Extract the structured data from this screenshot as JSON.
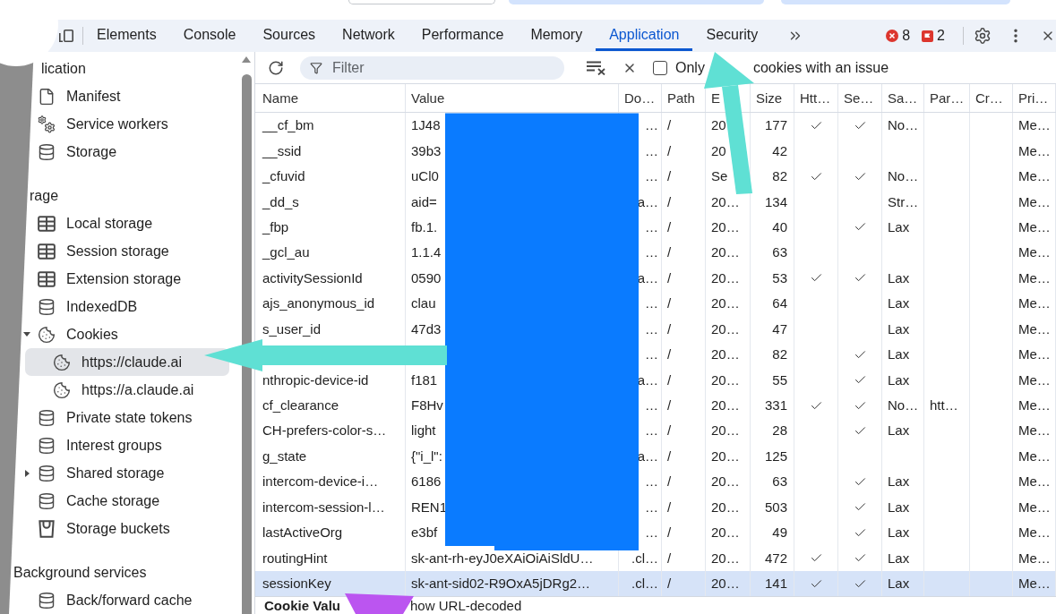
{
  "tabs": [
    {
      "label": "Elements",
      "selected": false
    },
    {
      "label": "Console",
      "selected": false
    },
    {
      "label": "Sources",
      "selected": false
    },
    {
      "label": "Network",
      "selected": false
    },
    {
      "label": "Performance",
      "selected": false
    },
    {
      "label": "Memory",
      "selected": false
    },
    {
      "label": "Application",
      "selected": true
    },
    {
      "label": "Security",
      "selected": false
    }
  ],
  "counters": {
    "errors": "8",
    "issues": "2"
  },
  "sidebar": {
    "sections": [
      {
        "title": "lication",
        "items": [
          {
            "label": "Manifest",
            "kind": "file",
            "selected": false
          },
          {
            "label": "Service workers",
            "kind": "gears",
            "selected": false
          },
          {
            "label": "Storage",
            "kind": "database",
            "selected": false
          }
        ]
      },
      {
        "title": "rage",
        "items": [
          {
            "label": "Local storage",
            "kind": "table",
            "selected": false
          },
          {
            "label": "Session storage",
            "kind": "table",
            "selected": false
          },
          {
            "label": "Extension storage",
            "kind": "table",
            "selected": false
          },
          {
            "label": "IndexedDB",
            "kind": "database",
            "selected": false
          },
          {
            "label": "Cookies",
            "kind": "cookie",
            "selected": false,
            "expanded": true,
            "children": [
              {
                "label": "https://claude.ai",
                "kind": "cookie",
                "selected": true
              },
              {
                "label": "https://a.claude.ai",
                "kind": "cookie",
                "selected": false
              }
            ]
          },
          {
            "label": "Private state tokens",
            "kind": "database",
            "selected": false
          },
          {
            "label": "Interest groups",
            "kind": "database",
            "selected": false
          },
          {
            "label": "Shared storage",
            "kind": "database",
            "selected": false,
            "expanded": false
          },
          {
            "label": "Cache storage",
            "kind": "database",
            "selected": false
          },
          {
            "label": "Storage buckets",
            "kind": "bucket",
            "selected": false
          }
        ]
      },
      {
        "title": "Background services",
        "items": [
          {
            "label": "Back/forward cache",
            "kind": "database",
            "selected": false
          }
        ]
      }
    ]
  },
  "toolbar": {
    "filter": {
      "placeholder": "Filter"
    },
    "only_issues": {
      "checked": false,
      "label": [
        "Only",
        "cookies with an issue"
      ]
    }
  },
  "table": {
    "columns": [
      "Name",
      "Value",
      "Do…",
      "Path",
      "E",
      "Size",
      "Htt…",
      "Se…",
      "Sa…",
      "Par…",
      "Cr…",
      "Pri…"
    ],
    "rows": [
      {
        "name": "__cf_bm",
        "value": "1J48",
        "domain": "…",
        "path": "/",
        "expires": "20",
        "size": "177",
        "http_only": true,
        "secure": true,
        "same_site": "No…",
        "priority": "Me…",
        "selected": false
      },
      {
        "name": "__ssid",
        "value": "39b3",
        "domain": "…",
        "path": "/",
        "expires": "20",
        "size": "42",
        "http_only": false,
        "secure": false,
        "priority": "Me…",
        "selected": false
      },
      {
        "name": "_cfuvid",
        "value": "uCl0",
        "domain": "…",
        "path": "/",
        "expires": "Se",
        "size": "82",
        "http_only": true,
        "secure": true,
        "same_site": "No…",
        "priority": "Me…",
        "selected": false
      },
      {
        "name": "_dd_s",
        "value": "aid=",
        "domain": "a…",
        "path": "/",
        "expires": "20…",
        "size": "134",
        "http_only": false,
        "secure": false,
        "same_site": "Str…",
        "priority": "Me…",
        "selected": false
      },
      {
        "name": "_fbp",
        "value": "fb.1.",
        "domain": "…",
        "path": "/",
        "expires": "20…",
        "size": "40",
        "http_only": false,
        "secure": true,
        "same_site": "Lax",
        "priority": "Me…",
        "selected": false
      },
      {
        "name": "_gcl_au",
        "value": "1.1.4",
        "domain": "…",
        "path": "/",
        "expires": "20…",
        "size": "63",
        "http_only": false,
        "secure": false,
        "priority": "Me…",
        "selected": false
      },
      {
        "name": "activitySessionId",
        "value": "0590",
        "domain": "a…",
        "path": "/",
        "expires": "20…",
        "size": "53",
        "http_only": true,
        "secure": true,
        "same_site": "Lax",
        "priority": "Me…",
        "selected": false
      },
      {
        "name": "ajs_anonymous_id",
        "value": "clau",
        "domain": "…",
        "path": "/",
        "expires": "20…",
        "size": "64",
        "http_only": false,
        "secure": false,
        "same_site": "Lax",
        "priority": "Me…",
        "selected": false
      },
      {
        "name": "s_user_id",
        "value": "47d3",
        "domain": "…",
        "path": "/",
        "expires": "20…",
        "size": "47",
        "http_only": false,
        "secure": false,
        "same_site": "Lax",
        "priority": "Me…",
        "selected": false
      },
      {
        "domain": "…",
        "path": "/",
        "expires": "20…",
        "size": "82",
        "http_only": false,
        "secure": true,
        "same_site": "Lax",
        "priority": "Me…",
        "selected": false
      },
      {
        "name": "nthropic-device-id",
        "value": "f181",
        "domain": "a…",
        "path": "/",
        "expires": "20…",
        "size": "55",
        "http_only": false,
        "secure": true,
        "same_site": "Lax",
        "priority": "Me…",
        "selected": false
      },
      {
        "name": "cf_clearance",
        "value": "F8Hv",
        "domain": "…",
        "path": "/",
        "expires": "20…",
        "size": "331",
        "http_only": true,
        "secure": true,
        "same_site": "No…",
        "partition_key": "htt…",
        "priority": "Me…",
        "selected": false
      },
      {
        "name": "CH-prefers-color-s…",
        "value": "light",
        "domain": "…",
        "path": "/",
        "expires": "20…",
        "size": "28",
        "http_only": false,
        "secure": true,
        "same_site": "Lax",
        "priority": "Me…",
        "selected": false
      },
      {
        "name": "g_state",
        "value": "{\"i_l\":",
        "domain": "a…",
        "path": "/",
        "expires": "20…",
        "size": "125",
        "http_only": false,
        "secure": false,
        "priority": "Me…",
        "selected": false
      },
      {
        "name": "intercom-device-i…",
        "value": "6186",
        "domain": "…",
        "path": "/",
        "expires": "20…",
        "size": "63",
        "http_only": false,
        "secure": true,
        "same_site": "Lax",
        "priority": "Me…",
        "selected": false
      },
      {
        "name": "intercom-session-l…",
        "value": "REN1",
        "domain": "…",
        "path": "/",
        "expires": "20…",
        "size": "503",
        "http_only": false,
        "secure": true,
        "same_site": "Lax",
        "priority": "Me…",
        "selected": false
      },
      {
        "name": "lastActiveOrg",
        "value": "e3bf",
        "domain": "…",
        "path": "/",
        "expires": "20…",
        "size": "49",
        "http_only": false,
        "secure": true,
        "same_site": "Lax",
        "priority": "Me…",
        "selected": false
      },
      {
        "name": "routingHint",
        "value": "sk-ant-rh-eyJ0eXAiOiAiSldU…",
        "domain": ".cl…",
        "path": "/",
        "expires": "20…",
        "size": "472",
        "http_only": true,
        "secure": true,
        "same_site": "Lax",
        "priority": "Me…",
        "selected": false
      },
      {
        "name": "sessionKey",
        "value": "sk-ant-sid02-R9OxA5jDRg2…",
        "domain": ".cl…",
        "path": "/",
        "expires": "20…",
        "size": "141",
        "http_only": true,
        "secure": true,
        "same_site": "Lax",
        "priority": "Me…",
        "selected": true
      }
    ]
  },
  "detail": {
    "title": "Cookie Valu",
    "option_label": "how URL-decoded"
  }
}
